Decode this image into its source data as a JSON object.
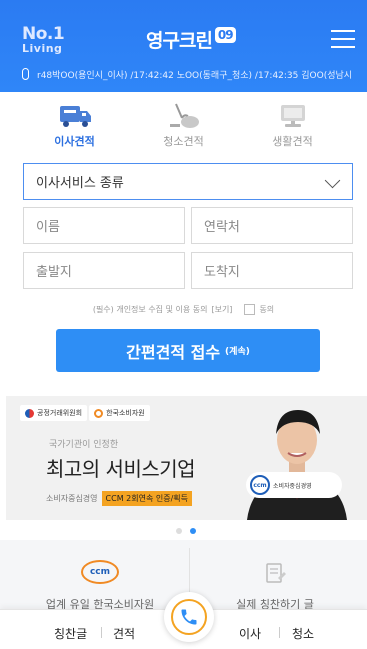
{
  "header": {
    "logo_line1": "No.1",
    "logo_line2": "Living",
    "brand": "영구크린",
    "brand_badge": "09",
    "ticker": "r48박OO(용인시_이사) /17:42:42 노OO(동래구_청소) /17:42:35 김OO(성남시"
  },
  "tabs": [
    {
      "label": "이사견적",
      "icon": "moving-truck-icon",
      "active": true
    },
    {
      "label": "청소견적",
      "icon": "vacuum-cleaner-icon",
      "active": false
    },
    {
      "label": "생활견적",
      "icon": "tv-appliance-icon",
      "active": false
    }
  ],
  "form": {
    "service_select": "이사서비스 종류",
    "name_placeholder": "이름",
    "contact_placeholder": "연락처",
    "origin_placeholder": "출발지",
    "destination_placeholder": "도착지",
    "consent_text": "(필수) 개인정보 수집 및 이용 동의",
    "consent_view": "[보기]",
    "consent_agree": "동의",
    "submit_label": "간편견적 접수",
    "submit_sub": "(계속)"
  },
  "banner": {
    "org1": "공정거래위원회",
    "org2": "한국소비자원",
    "line1": "국가기관이 인정한",
    "line2": "최고의 서비스기업",
    "line3": "소비자중심경영",
    "highlight": "CCM 2회연속 인증/획득",
    "ccm_badge": "ccm",
    "ccm_caption": "소비자중심경영"
  },
  "pager": {
    "count": 2,
    "active": 1
  },
  "bottom_section": {
    "left_label": "업계 유일 한국소비자원",
    "left_logo": "ccm",
    "right_label": "실제 칭찬하기 글"
  },
  "navbar": {
    "item1": "칭찬글",
    "item2": "견적",
    "item3": "이사",
    "item4": "청소"
  },
  "colors": {
    "primary": "#2e8ef5",
    "header": "#2b7bf2",
    "accent": "#f4a321"
  }
}
